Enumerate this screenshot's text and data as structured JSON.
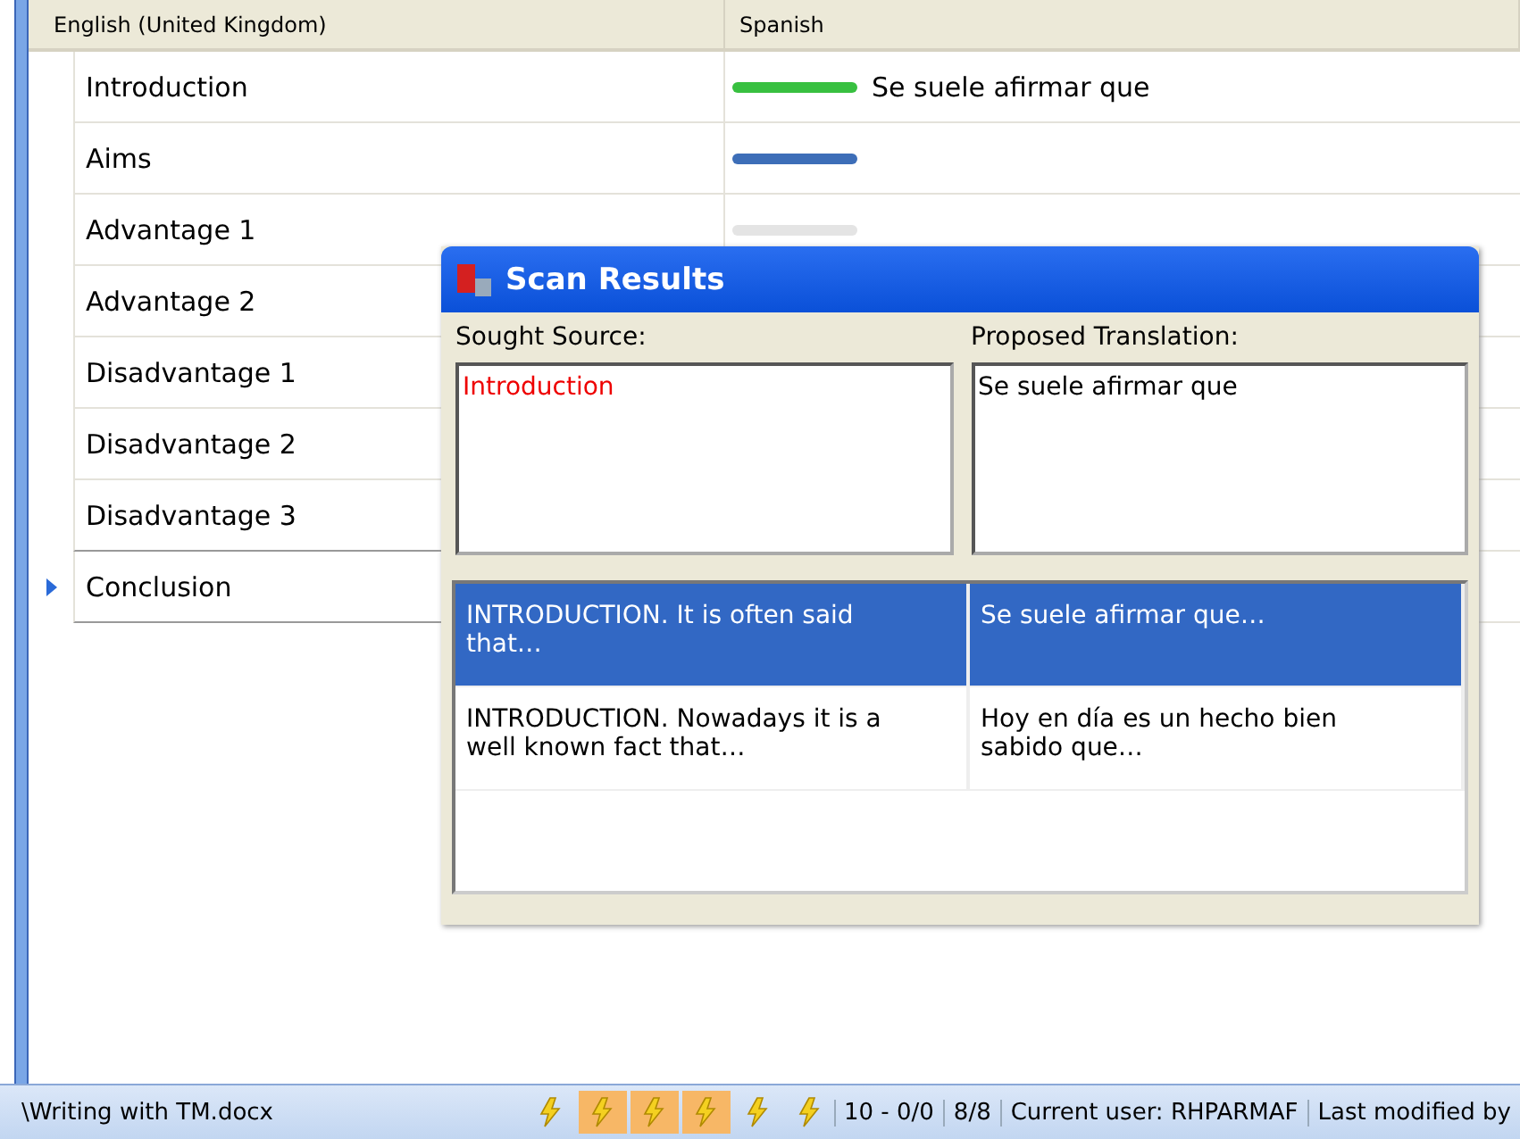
{
  "grid": {
    "columns": [
      "English (United Kingdom)",
      "Spanish"
    ],
    "rows": [
      {
        "source": "Introduction",
        "color": "#38c040",
        "target": "Se suele afirmar que",
        "current": false
      },
      {
        "source": "Aims",
        "color": "#3d6eb8",
        "current": false
      },
      {
        "source": "Advantage 1",
        "color": "#e4e4e4",
        "current": false
      },
      {
        "source": "Advantage 2",
        "current": false
      },
      {
        "source": "Disadvantage 1",
        "current": false
      },
      {
        "source": "Disadvantage 2",
        "current": false
      },
      {
        "source": "Disadvantage 3",
        "current": false
      },
      {
        "source": "Conclusion",
        "current": true
      }
    ]
  },
  "dialog": {
    "title": "Scan Results",
    "source_label": "Sought Source:",
    "source_value": "Introduction",
    "translation_label": "Proposed Translation:",
    "translation_value": "Se suele afirmar que",
    "results": [
      {
        "source": "INTRODUCTION. It is often said that…",
        "target": "Se suele afirmar que…",
        "selected": true
      },
      {
        "source": "INTRODUCTION. Nowadays it is a well known fact that…",
        "target": "Hoy en día es un hecho bien sabido que…",
        "selected": false
      }
    ]
  },
  "status_bar": {
    "file": "\\Writing with TM.docx",
    "tools": [
      {
        "active": false
      },
      {
        "active": true
      },
      {
        "active": true
      },
      {
        "active": true
      },
      {
        "active": false
      },
      {
        "active": false
      }
    ],
    "fields": [
      "10 - 0/0",
      "8/8",
      "Current user: RHPARMAF",
      "Last modified by"
    ]
  }
}
